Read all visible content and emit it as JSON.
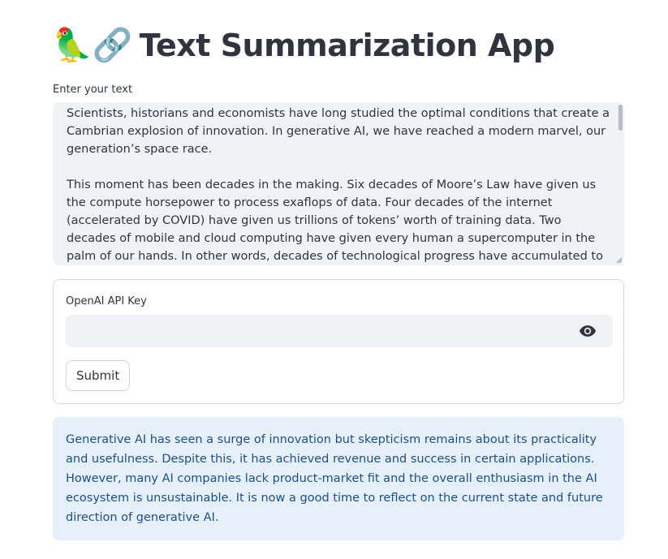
{
  "header": {
    "emoji": "🦜🔗",
    "title": "Text Summarization App"
  },
  "text_input": {
    "label": "Enter your text",
    "value": "Scientists, historians and economists have long studied the optimal conditions that create a Cambrian explosion of innovation. In generative AI, we have reached a modern marvel, our generation’s space race.\n\nThis moment has been decades in the making. Six decades of Moore’s Law have given us the compute horsepower to process exaflops of data. Four decades of the internet (accelerated by COVID) have given us trillions of tokens’ worth of training data. Two decades of mobile and cloud computing have given every human a supercomputer in the palm of our hands. In other words, decades of technological progress have accumulated to create the necessary conditions for"
  },
  "form": {
    "api_key_label": "OpenAI API Key",
    "api_key_value": "",
    "submit_label": "Submit"
  },
  "result": {
    "text": "Generative AI has seen a surge of innovation but skepticism remains about its practicality and usefulness. Despite this, it has achieved revenue and success in certain applications. However, many AI companies lack product-market fit and the overall enthusiasm in the AI ecosystem is unsustainable. It is now a good time to reflect on the current state and future direction of generative AI."
  },
  "colors": {
    "text": "#31333f",
    "input_bg": "#f0f2f6",
    "info_bg": "#e5f0fb",
    "info_text": "#1f4e8a"
  },
  "icons": {
    "visibility_toggle": "eye-icon"
  }
}
